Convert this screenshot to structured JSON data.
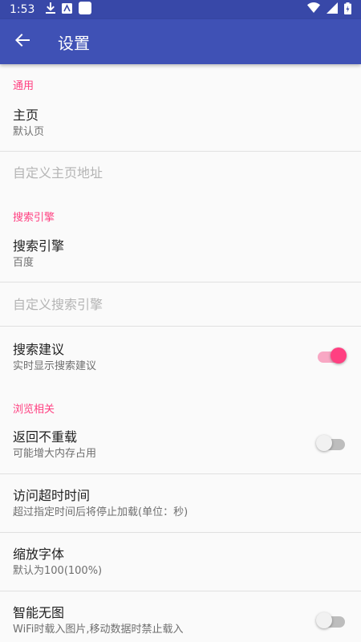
{
  "status_bar": {
    "time": "1:53",
    "icons": [
      "download-icon",
      "app-icon",
      "notification-icon",
      "wifi-icon",
      "signal-icon",
      "battery-icon"
    ]
  },
  "app_bar": {
    "title": "设置",
    "back_icon": "arrow-left-icon"
  },
  "sections": {
    "general": {
      "header": "通用",
      "homepage": {
        "title": "主页",
        "summary": "默认页"
      },
      "custom_homepage": {
        "title": "自定义主页地址"
      }
    },
    "search": {
      "header": "搜索引擎",
      "engine": {
        "title": "搜索引擎",
        "summary": "百度"
      },
      "custom_engine": {
        "title": "自定义搜索引擎"
      },
      "suggestions": {
        "title": "搜索建议",
        "summary": "实时显示搜索建议",
        "enabled": true
      }
    },
    "browsing": {
      "header": "浏览相关",
      "back_no_reload": {
        "title": "返回不重载",
        "summary": "可能增大内存占用",
        "enabled": false
      },
      "timeout": {
        "title": "访问超时时间",
        "summary": "超过指定时间后将停止加载(单位：秒)"
      },
      "font_scale": {
        "title": "缩放字体",
        "summary": "默认为100(100%)"
      },
      "no_images": {
        "title": "智能无图",
        "summary": "WiFi时载入图片,移动数据时禁止载入",
        "enabled": false
      }
    }
  },
  "colors": {
    "app_bar": "#3f51b5",
    "status_bar": "#3848a8",
    "accent": "#ff4081",
    "background": "#fafafa"
  }
}
